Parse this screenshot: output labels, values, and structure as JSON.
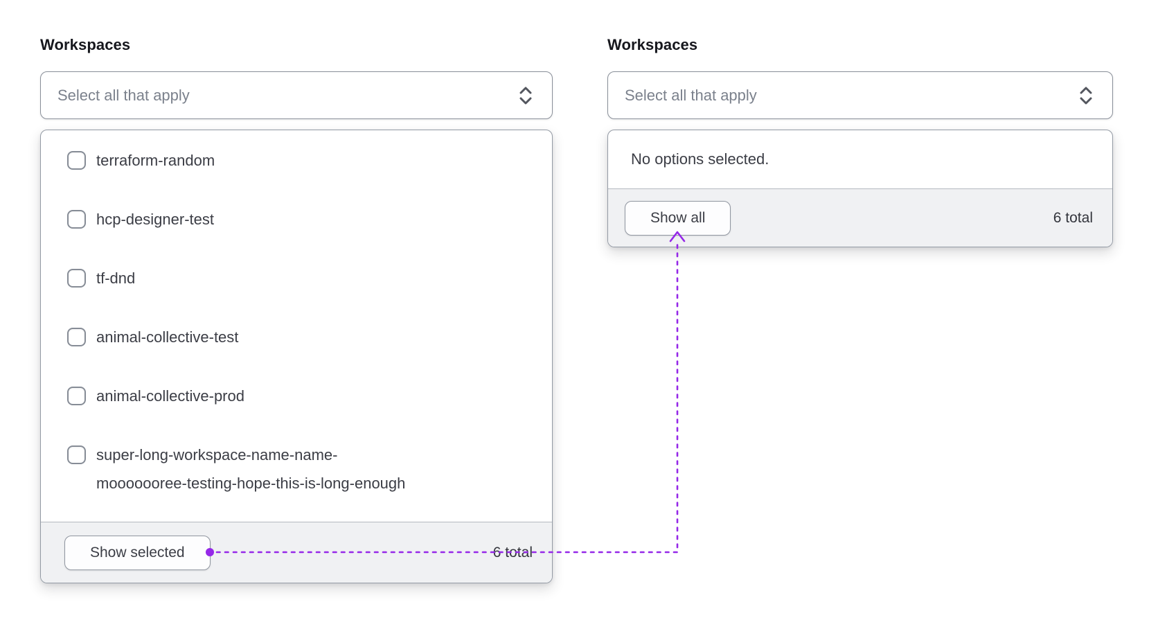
{
  "colors": {
    "accent_purple": "#9528e8",
    "footer_background": "#f0f1f3",
    "control_border": "#898f99",
    "text_primary": "#3b3d45",
    "placeholder_text": "#7b818c"
  },
  "left_combobox": {
    "label": "Workspaces",
    "trigger": {
      "placeholder": "Select all that apply",
      "icon": "chevron-up-down-icon"
    },
    "dropdown": {
      "options": [
        {
          "label": "terraform-random",
          "checked": false
        },
        {
          "label": "hcp-designer-test",
          "checked": false
        },
        {
          "label": "tf-dnd",
          "checked": false
        },
        {
          "label": "animal-collective-test",
          "checked": false
        },
        {
          "label": "animal-collective-prod",
          "checked": false
        },
        {
          "label": "super-long-workspace-name-name-mooooooree-testing-hope-this-is-long-enough",
          "label_line1": "super-long-workspace-name-name-",
          "label_line2": "mooooooree-testing-hope-this-is-long-enough",
          "checked": false
        }
      ],
      "footer": {
        "button_label": "Show selected",
        "total_label": "6 total"
      }
    }
  },
  "right_combobox": {
    "label": "Workspaces",
    "trigger": {
      "placeholder": "Select all that apply",
      "icon": "chevron-up-down-icon"
    },
    "dropdown": {
      "empty_message": "No options selected.",
      "footer": {
        "button_label": "Show all",
        "total_label": "6 total"
      }
    }
  },
  "annotation": {
    "description": "dotted connector from Show selected button to Show all button"
  }
}
